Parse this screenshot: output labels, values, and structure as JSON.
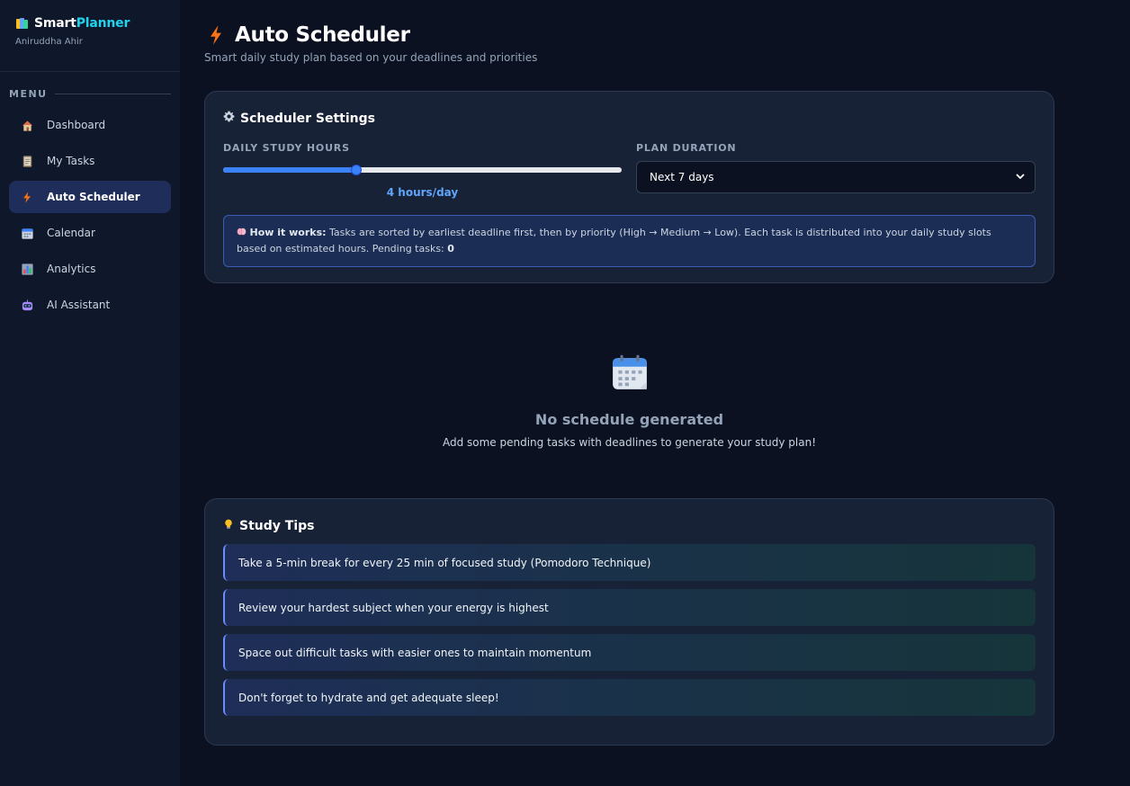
{
  "brand": {
    "name_part1": "Smart",
    "name_part2": "Planner",
    "user": "Aniruddha Ahir",
    "logo_icon": "books-icon"
  },
  "sidebar": {
    "menu_label": "MENU",
    "items": [
      {
        "label": "Dashboard",
        "icon": "house-icon",
        "active": false
      },
      {
        "label": "My Tasks",
        "icon": "notebook-icon",
        "active": false
      },
      {
        "label": "Auto Scheduler",
        "icon": "lightning-icon",
        "active": true
      },
      {
        "label": "Calendar",
        "icon": "calendar-icon",
        "active": false
      },
      {
        "label": "Analytics",
        "icon": "bar-chart-icon",
        "active": false
      },
      {
        "label": "AI Assistant",
        "icon": "robot-icon",
        "active": false
      }
    ]
  },
  "header": {
    "title": "Auto Scheduler",
    "subtitle": "Smart daily study plan based on your deadlines and priorities"
  },
  "settings": {
    "title": "Scheduler Settings",
    "daily_hours_label": "DAILY STUDY HOURS",
    "daily_hours_value": 4,
    "daily_hours_min": 1,
    "daily_hours_max": 10,
    "daily_hours_text": "4 hours/day",
    "plan_duration_label": "PLAN DURATION",
    "plan_duration_value": "Next 7 days",
    "info_bold": "How it works:",
    "info_text": "Tasks are sorted by earliest deadline first, then by priority (High → Medium → Low). Each task is distributed into your daily study slots based on estimated hours. Pending tasks:",
    "pending_count": "0"
  },
  "empty_state": {
    "title": "No schedule generated",
    "subtitle": "Add some pending tasks with deadlines to generate your study plan!"
  },
  "tips": {
    "title": "Study Tips",
    "items": [
      "Take a 5-min break for every 25 min of focused study (Pomodoro Technique)",
      "Review your hardest subject when your energy is highest",
      "Space out difficult tasks with easier ones to maintain momentum",
      "Don't forget to hydrate and get adequate sleep!"
    ]
  },
  "colors": {
    "accent": "#3b82f6",
    "brand_cyan": "#22d3ee",
    "background": "#0b1120",
    "card": "#182236"
  }
}
